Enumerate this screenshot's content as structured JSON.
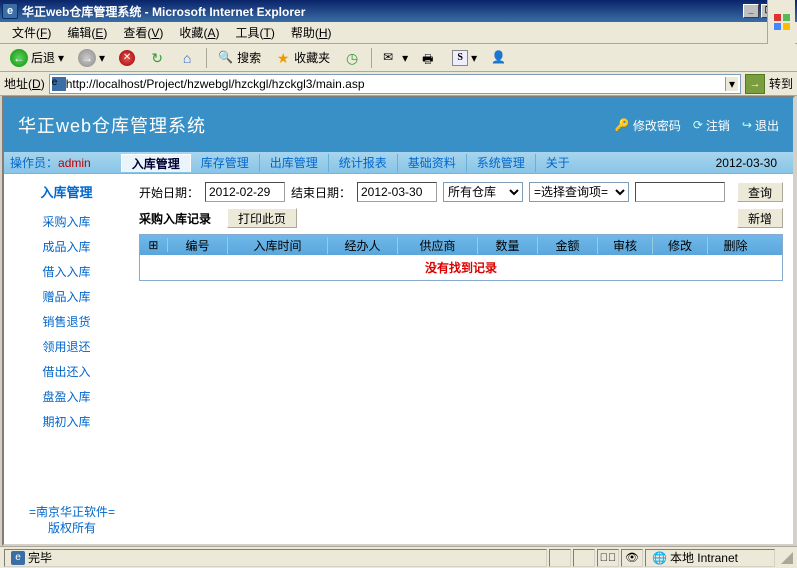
{
  "window": {
    "title": "华正web仓库管理系统 - Microsoft Internet Explorer"
  },
  "menubar": {
    "file": "文件",
    "file_hot": "F",
    "edit": "编辑",
    "edit_hot": "E",
    "view": "查看",
    "view_hot": "V",
    "favorites": "收藏",
    "favorites_hot": "A",
    "tools": "工具",
    "tools_hot": "T",
    "help": "帮助",
    "help_hot": "H"
  },
  "toolbar": {
    "back": "后退",
    "search": "搜索",
    "favorites": "收藏夹"
  },
  "addressbar": {
    "label": "地址",
    "label_hot": "D",
    "url": "http://localhost/Project/hzwebgl/hzckgl/hzckgl3/main.asp",
    "go": "转到"
  },
  "app": {
    "title": "华正web仓库管理系统",
    "changepw": "修改密码",
    "logout": "注销",
    "exit": "退出",
    "operator_label": "操作员：",
    "operator": "admin",
    "date": "2012-03-30"
  },
  "topnav": [
    "入库管理",
    "库存管理",
    "出库管理",
    "统计报表",
    "基础资料",
    "系统管理",
    "关于"
  ],
  "sidebar": {
    "title": "入库管理",
    "items": [
      "采购入库",
      "成品入库",
      "借入入库",
      "赠品入库",
      "销售退货",
      "领用退还",
      "借出还入",
      "盘盈入库",
      "期初入库"
    ],
    "footer1": "=南京华正软件=",
    "footer2": "版权所有"
  },
  "filters": {
    "start_label": "开始日期：",
    "start": "2012-02-29",
    "end_label": "结束日期：",
    "end": "2012-03-30",
    "warehouse": "所有仓库",
    "queryfield": "=选择查询项=",
    "keyword": "",
    "search_btn": "查询",
    "section_title": "采购入库记录",
    "print_btn": "打印此页",
    "add_btn": "新增"
  },
  "grid": {
    "headers": {
      "plus": "",
      "id": "编号",
      "time": "入库时间",
      "op": "经办人",
      "sup": "供应商",
      "qty": "数量",
      "amt": "金额",
      "aud": "审核",
      "mod": "修改",
      "del": "删除"
    },
    "norecord": "没有找到记录"
  },
  "statusbar": {
    "done": "完毕",
    "zone": "本地 Intranet"
  },
  "icons": {
    "plus": "⊞"
  }
}
